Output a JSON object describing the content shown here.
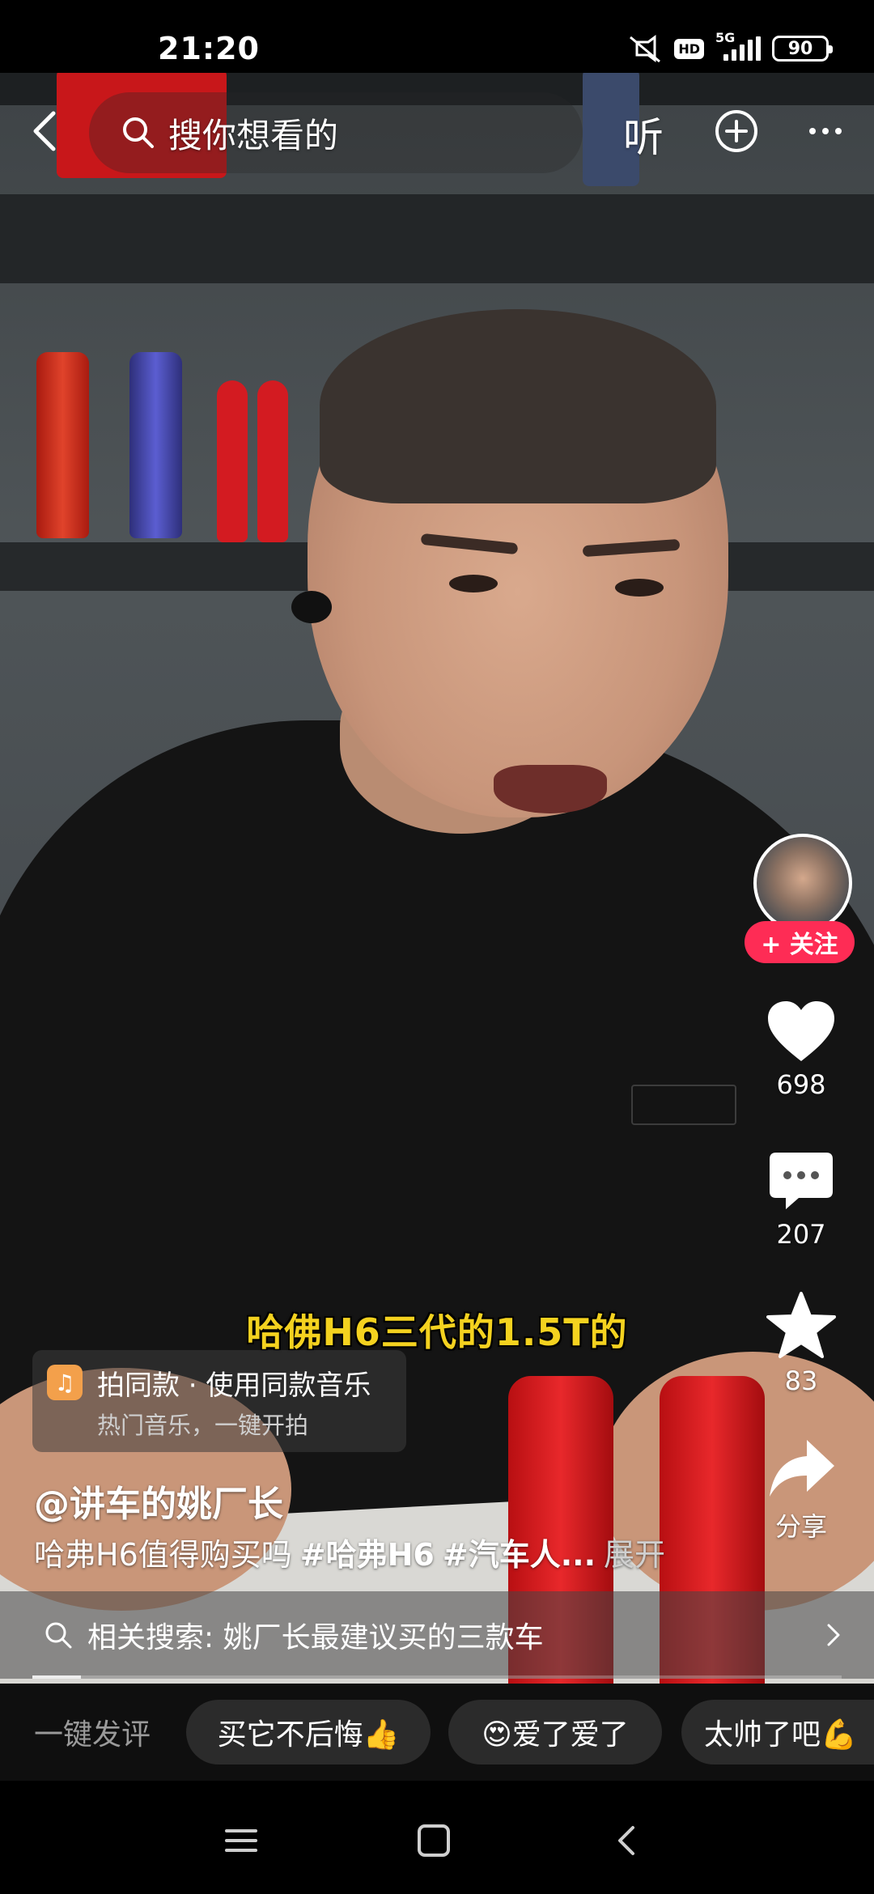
{
  "status_bar": {
    "time": "21:20",
    "hd": "HD",
    "network": "5G",
    "battery": "90"
  },
  "top_bar": {
    "search_placeholder": "搜你想看的",
    "listen_label": "听"
  },
  "video": {
    "subtitle": "哈佛H6三代的1.5T的"
  },
  "rail": {
    "follow_label": "+ 关注",
    "like_count": "698",
    "comment_count": "207",
    "favorite_count": "83",
    "share_label": "分享"
  },
  "music": {
    "line1": "拍同款 · 使用同款音乐",
    "line2": "热门音乐，一键开拍"
  },
  "caption": {
    "author": "@讲车的姚厂长",
    "text": "哈弗H6值得购买吗",
    "tag1": "#哈弗H6",
    "tag2": "#汽车人...",
    "expand": "展开"
  },
  "related_search": {
    "text": "相关搜索: 姚厂长最建议买的三款车"
  },
  "playback": {
    "progress": 0.06
  },
  "quick_comments": {
    "label": "一键发评",
    "chips": [
      "买它不后悔👍",
      "😍爱了爱了",
      "太帅了吧💪"
    ]
  },
  "colors": {
    "accent": "#fe2c55",
    "subtitle": "#f4d21f",
    "music_icon": "#f3a04b"
  },
  "icons": [
    "back-icon",
    "search-icon",
    "add-icon",
    "more-icon",
    "heart-icon",
    "comment-icon",
    "star-icon",
    "share-icon",
    "music-icon",
    "chevron-right-icon",
    "menu-icon",
    "home-icon",
    "back-nav-icon"
  ]
}
